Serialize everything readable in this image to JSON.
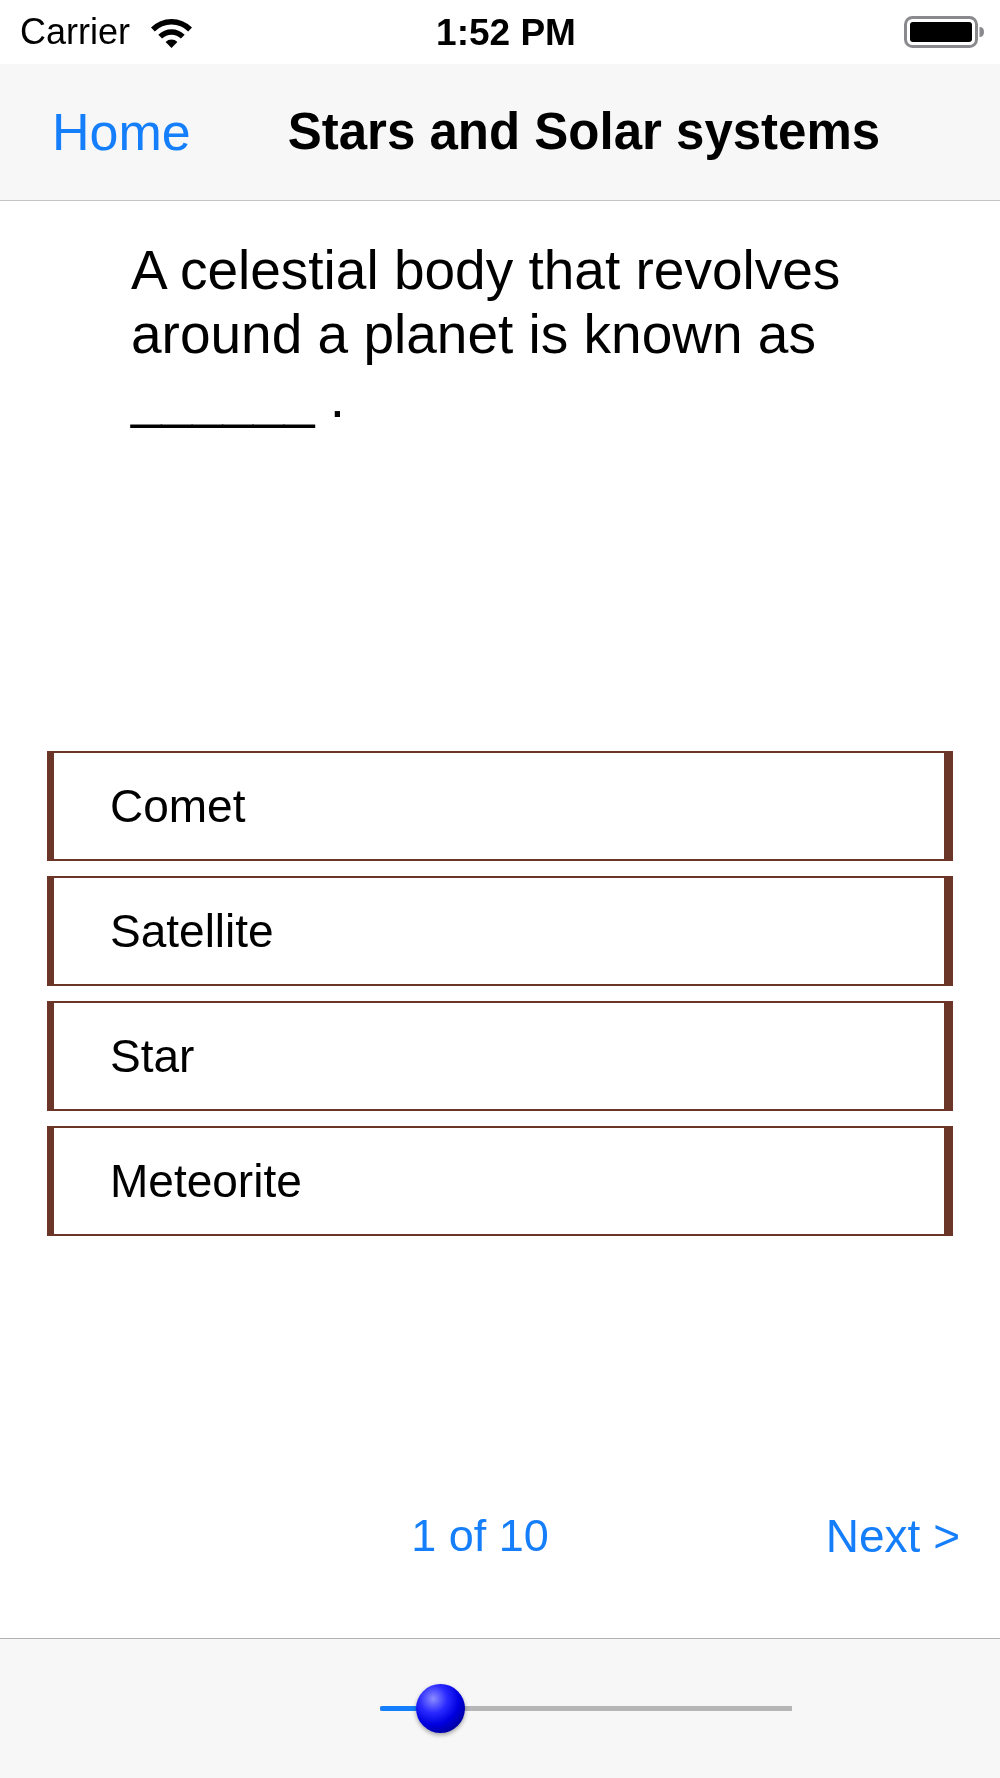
{
  "status_bar": {
    "carrier": "Carrier",
    "time": "1:52 PM"
  },
  "nav_bar": {
    "back": "Home",
    "title": "Stars and Solar systems"
  },
  "question": {
    "text": "A celestial body that revolves around a planet is known as ______ ."
  },
  "options": [
    {
      "label": "Comet",
      "selected": false
    },
    {
      "label": "Satellite",
      "selected": false
    },
    {
      "label": "Star",
      "selected": false
    },
    {
      "label": "Meteorite",
      "selected": false
    }
  ],
  "footer": {
    "counter": "1 of 10",
    "next": "Next >"
  },
  "toolbar": {
    "slider": {
      "level": 0.1
    }
  }
}
